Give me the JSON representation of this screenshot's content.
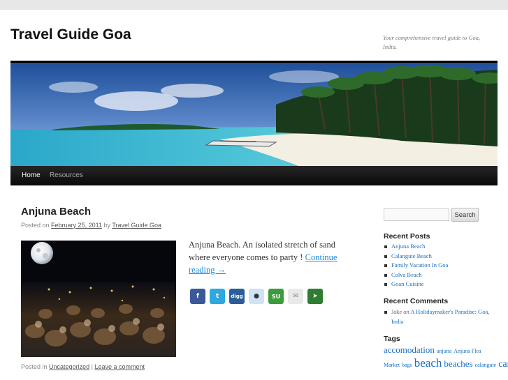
{
  "site": {
    "title": "Travel Guide Goa",
    "description": "Your comprehensive travel guide to Goa, India."
  },
  "nav": {
    "items": [
      {
        "label": "Home",
        "current": true
      },
      {
        "label": "Resources",
        "current": false
      }
    ]
  },
  "post": {
    "title": "Anjuna Beach",
    "meta_prefix": "Posted on",
    "date": "February 25, 2011",
    "meta_by": "by",
    "author": "Travel Guide Goa",
    "excerpt_text": "Anjuna Beach. An isolated stretch of sand where everyone comes to party ! ",
    "continue_label": "Continue reading →",
    "share_icons": [
      "facebook-icon",
      "twitter-icon",
      "digg-icon",
      "reddit-icon",
      "stumbleupon-icon",
      "email-icon",
      "share-icon"
    ],
    "util_prefix": "Posted in",
    "category": "Uncategorized",
    "util_sep": " | ",
    "comment_link": "Leave a comment"
  },
  "sidebar": {
    "search_placeholder": "",
    "search_button": "Search",
    "recent_posts_title": "Recent Posts",
    "recent_posts": [
      {
        "label": "Anjuna Beach"
      },
      {
        "label": "Calangute Beach"
      },
      {
        "label": "Family Vacation In Goa"
      },
      {
        "label": "Colva Beach"
      },
      {
        "label": "Goan Cuisine"
      }
    ],
    "recent_comments_title": "Recent Comments",
    "recent_comment": {
      "author": "Jake",
      "on": "on",
      "post": "A Holidaymaker's Paradise: Goa, India"
    },
    "tags_title": "Tags",
    "tags": [
      {
        "label": "accomodation"
      },
      {
        "label": "anjuna"
      },
      {
        "label": "Anjuna Flea Market"
      },
      {
        "label": "bags"
      },
      {
        "label": "beach"
      },
      {
        "label": "beaches"
      },
      {
        "label": "calangute"
      },
      {
        "label": "carnival"
      }
    ]
  },
  "colors": {
    "link": "#1b6fc0",
    "nav_bg": "#111111",
    "page_bg": "#e7e7e7"
  }
}
